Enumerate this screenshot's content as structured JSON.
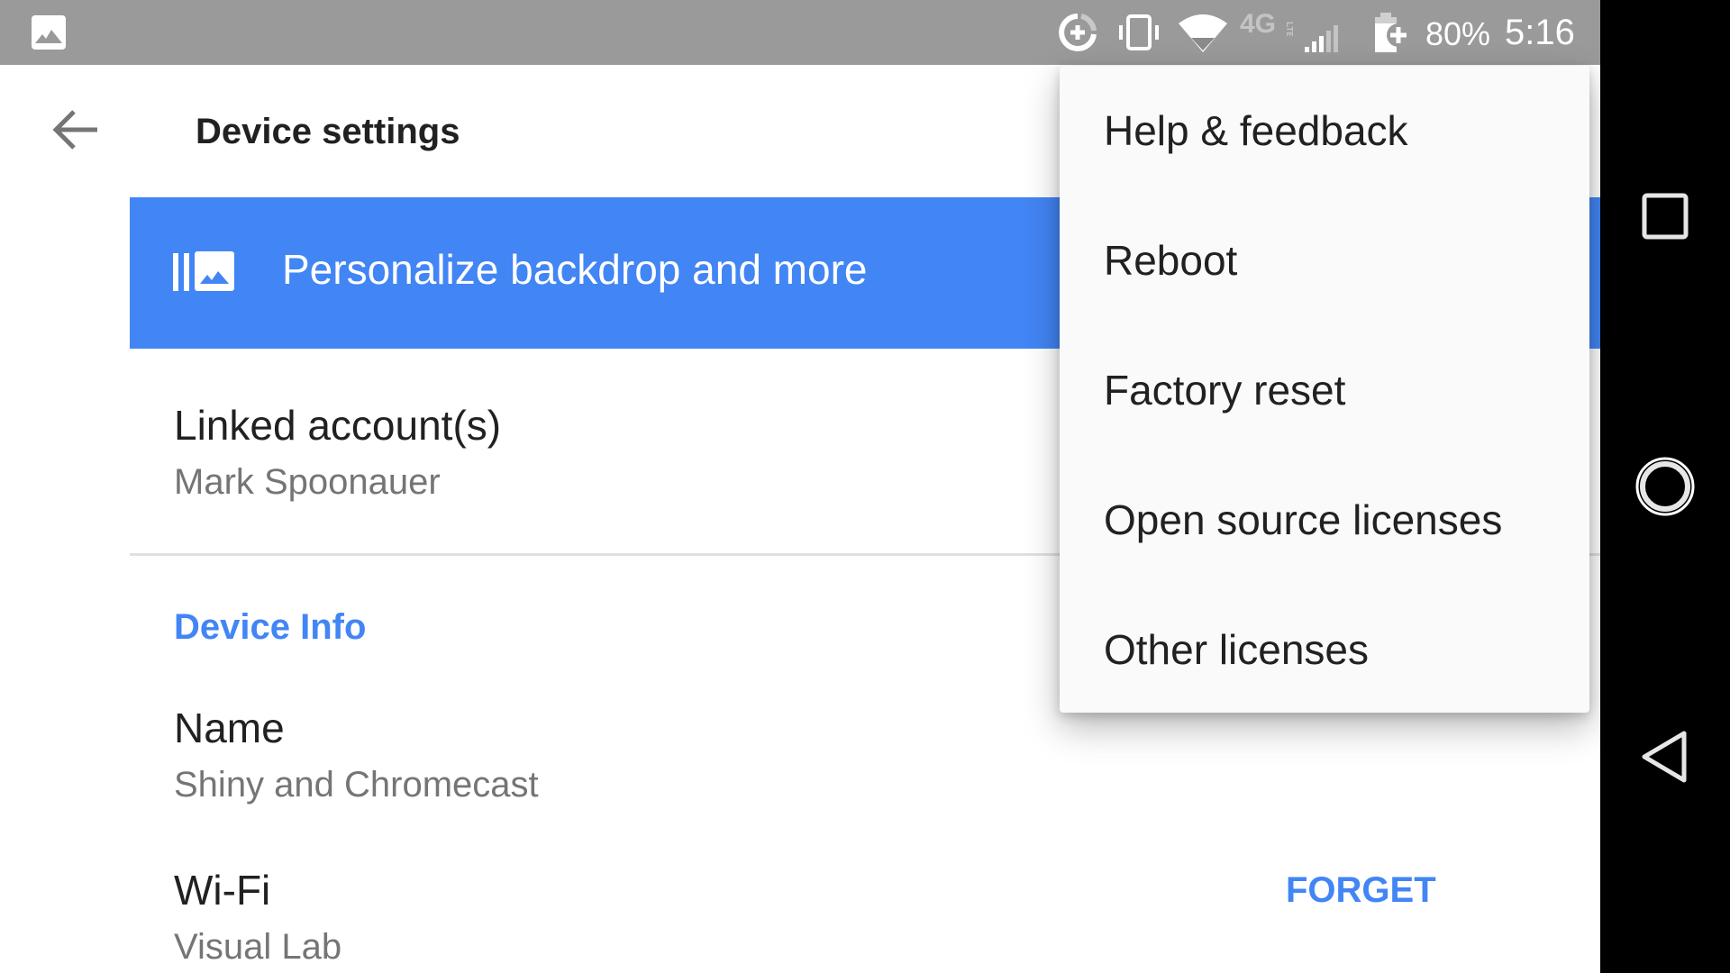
{
  "status_bar": {
    "notification_icon": "image-icon",
    "icons": [
      "data-saver-icon",
      "vibrate-icon",
      "wifi-icon",
      "4g-lte-icon",
      "signal-icon",
      "battery-charging-icon"
    ],
    "battery": "80%",
    "time": "5:16"
  },
  "header": {
    "back_icon": "arrow-back-icon",
    "title": "Device settings"
  },
  "banner": {
    "icon": "backdrop-icon",
    "label": "Personalize backdrop and more"
  },
  "linked_accounts": {
    "title": "Linked account(s)",
    "value": "Mark Spoonauer"
  },
  "device_info": {
    "section_label": "Device Info",
    "name": {
      "title": "Name",
      "value": "Shiny and Chromecast"
    },
    "wifi": {
      "title": "Wi-Fi",
      "value": "Visual Lab",
      "action": "FORGET"
    }
  },
  "overflow_menu": {
    "items": [
      {
        "label": "Help & feedback"
      },
      {
        "label": "Reboot"
      },
      {
        "label": "Factory reset"
      },
      {
        "label": "Open source licenses"
      },
      {
        "label": "Other licenses"
      }
    ]
  },
  "nav_bar": {
    "buttons": [
      "recents-icon",
      "home-icon",
      "back-icon"
    ]
  },
  "colors": {
    "accent": "#4285f4",
    "status_bar": "#9a9a9a",
    "nav_bar": "#000000"
  }
}
